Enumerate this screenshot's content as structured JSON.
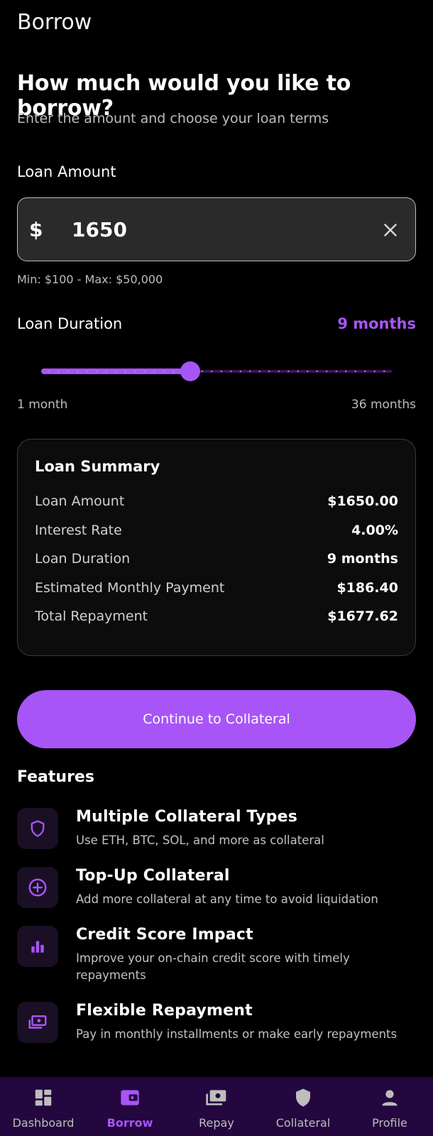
{
  "app": {
    "title": "Borrow"
  },
  "intro": {
    "heading": "How much would you like to borrow?",
    "subheading": "Enter the amount and choose your loan terms"
  },
  "loan_amount": {
    "label": "Loan Amount",
    "currency_symbol": "$",
    "value": "1650",
    "limits": "Min: $100 - Max: $50,000"
  },
  "duration": {
    "label": "Loan Duration",
    "value_text": "9 months",
    "min_label": "1 month",
    "max_label": "36 months",
    "min": 1,
    "max": 36,
    "current": 9
  },
  "summary": {
    "title": "Loan Summary",
    "rows": [
      {
        "label": "Loan Amount",
        "value": "$1650.00"
      },
      {
        "label": "Interest Rate",
        "value": "4.00%"
      },
      {
        "label": "Loan Duration",
        "value": "9 months"
      },
      {
        "label": "Estimated Monthly Payment",
        "value": "$186.40"
      },
      {
        "label": "Total Repayment",
        "value": "$1677.62"
      }
    ]
  },
  "cta": {
    "label": "Continue to Collateral"
  },
  "features": {
    "title": "Features",
    "items": [
      {
        "icon": "shield-icon",
        "title": "Multiple Collateral Types",
        "description": "Use ETH, BTC, SOL, and more as collateral"
      },
      {
        "icon": "plus-circle-icon",
        "title": "Top-Up Collateral",
        "description": "Add more collateral at any time to avoid liquidation"
      },
      {
        "icon": "bar-chart-icon",
        "title": "Credit Score Impact",
        "description": "Improve your on-chain credit score with timely repayments"
      },
      {
        "icon": "payments-icon",
        "title": "Flexible Repayment",
        "description": "Pay in monthly installments or make early repayments"
      }
    ]
  },
  "nav": {
    "active": "Borrow",
    "items": [
      {
        "label": "Dashboard",
        "icon": "dashboard-icon"
      },
      {
        "label": "Borrow",
        "icon": "wallet-icon"
      },
      {
        "label": "Repay",
        "icon": "payments-icon"
      },
      {
        "label": "Collateral",
        "icon": "shield-icon"
      },
      {
        "label": "Profile",
        "icon": "person-icon"
      }
    ]
  },
  "colors": {
    "accent": "#a855f7",
    "background": "#000000",
    "nav_background": "#24073f",
    "input_background": "#2a2a2a"
  }
}
